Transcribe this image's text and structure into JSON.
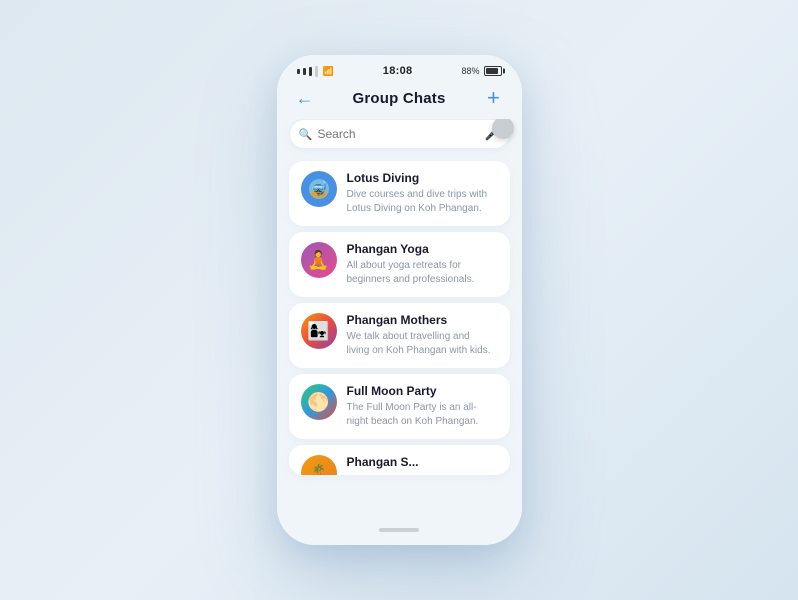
{
  "status_bar": {
    "signal": "▌▌▌",
    "wifi": "wifi",
    "time": "18:08",
    "battery_pct": "88%"
  },
  "header": {
    "title": "Group Chats",
    "back_label": "←",
    "add_label": "+"
  },
  "search": {
    "placeholder": "Search",
    "mic_icon": "mic"
  },
  "groups": [
    {
      "name": "Lotus Diving",
      "description": "Dive courses and dive trips with Lotus Diving on Koh Phangan.",
      "avatar_class": "avatar-lotus",
      "avatar_emoji": ""
    },
    {
      "name": "Phangan Yoga",
      "description": "All about yoga retreats  for beginners and professionals.",
      "avatar_class": "avatar-yoga",
      "avatar_emoji": "🧘"
    },
    {
      "name": "Phangan Mothers",
      "description": "We talk about travelling and living on Koh Phangan with kids.",
      "avatar_class": "avatar-mothers",
      "avatar_emoji": ""
    },
    {
      "name": "Full Moon Party",
      "description": "The Full Moon Party is an all-night beach on Koh Phangan.",
      "avatar_class": "avatar-fullmoon",
      "avatar_emoji": ""
    }
  ],
  "partial_group": {
    "name": "Phangan S...",
    "avatar_class": "avatar-phangan"
  }
}
